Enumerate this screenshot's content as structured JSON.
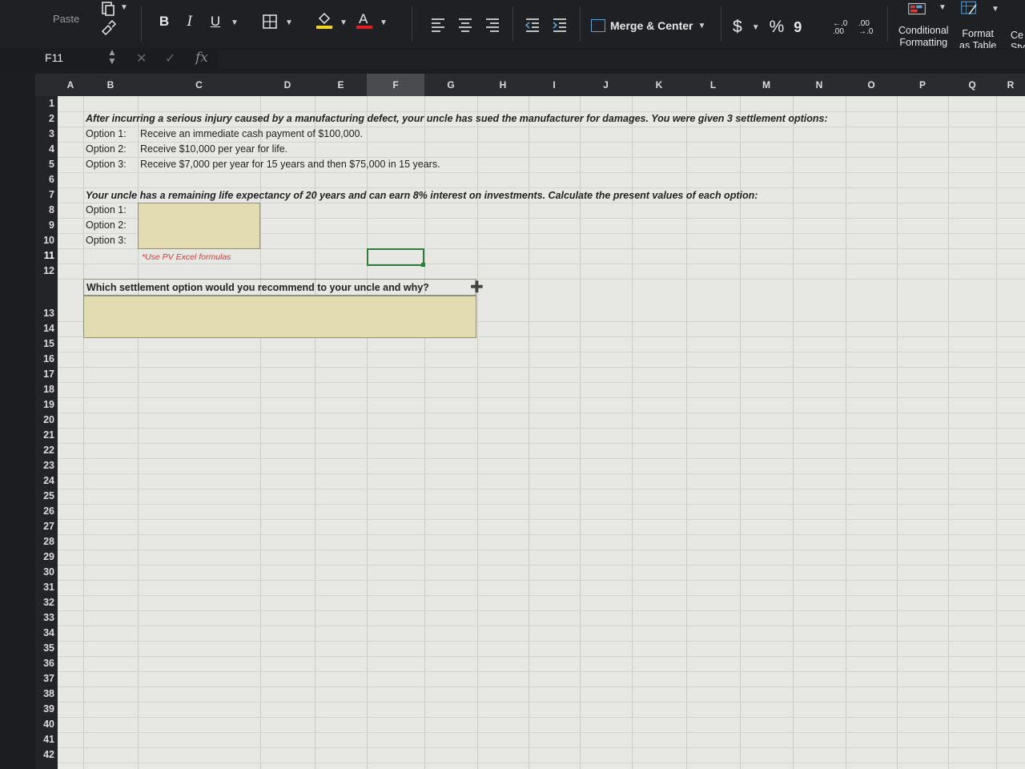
{
  "ribbon": {
    "paste_label": "Paste",
    "bold": "B",
    "italic": "I",
    "underline": "U",
    "merge_center": "Merge & Center",
    "currency": "$",
    "percent": "%",
    "comma": "9",
    "inc_decimal": "←.0 .00",
    "dec_decimal": ".00 →.0",
    "conditional_formatting": [
      "Conditional",
      "Formatting"
    ],
    "format_as_table": [
      "Format",
      "as Table"
    ],
    "cell_styles": [
      "Ce",
      "Sty"
    ]
  },
  "formula_bar": {
    "name_box": "F11",
    "fx": "fx",
    "value": ""
  },
  "columns": [
    "A",
    "B",
    "C",
    "D",
    "E",
    "F",
    "G",
    "H",
    "I",
    "J",
    "K",
    "L",
    "M",
    "N",
    "O",
    "P",
    "Q",
    "R"
  ],
  "rows": [
    "1",
    "2",
    "3",
    "4",
    "5",
    "6",
    "7",
    "8",
    "9",
    "10",
    "11",
    "12",
    "13",
    "14",
    "15",
    "16",
    "17",
    "18",
    "19",
    "20",
    "21",
    "22",
    "23",
    "24",
    "25",
    "26",
    "27",
    "28",
    "29",
    "30",
    "31",
    "32",
    "33",
    "34",
    "35",
    "36",
    "37",
    "38",
    "39",
    "40",
    "41",
    "42"
  ],
  "selected_cell": "F11",
  "sheet": {
    "intro": "After incurring a serious injury caused by a manufacturing defect, your uncle has sued the manufacturer for damages. You were given 3 settlement options:",
    "options": [
      {
        "label": "Option 1:",
        "text": "Receive an immediate cash payment of $100,000."
      },
      {
        "label": "Option 2:",
        "text": "Receive $10,000 per year for life."
      },
      {
        "label": "Option 3:",
        "text": "Receive $7,000 per year for 15 years and then $75,000 in 15 years."
      }
    ],
    "task": "Your uncle has a remaining life expectancy of 20 years and can earn 8% interest on investments. Calculate the present values of each option:",
    "pv_labels": [
      "Option 1:",
      "Option 2:",
      "Option 3:"
    ],
    "note": "*Use PV Excel formulas",
    "question": "Which settlement option would you recommend to your uncle and why?"
  },
  "colors": {
    "input_fill": "#e3dcb0",
    "selection": "#2f7d3a",
    "note": "#d23b3b"
  }
}
